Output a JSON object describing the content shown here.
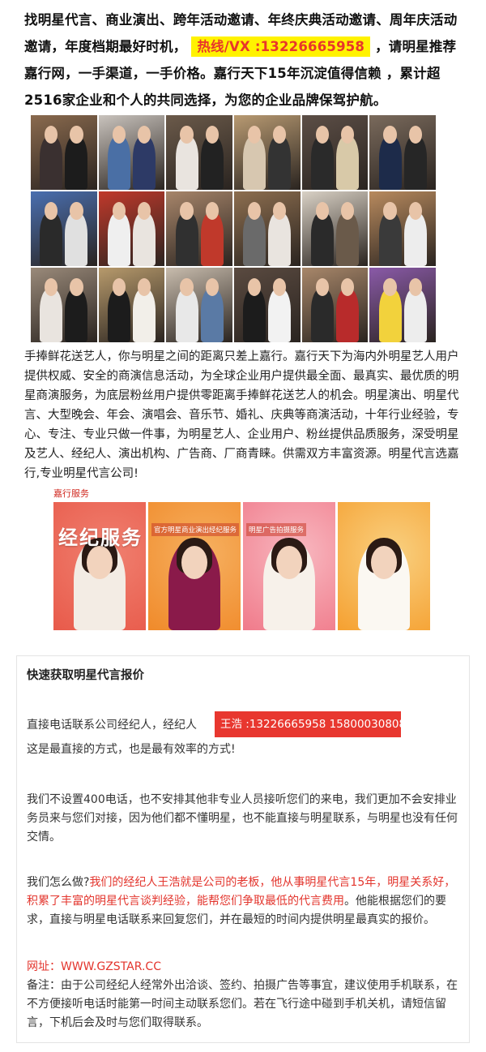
{
  "intro": {
    "text_before": "找明星代言、商业演出、跨年活动邀请、年终庆典活动邀请、周年庆活动邀请，年度档期最好时机，",
    "hotline": "热线/VX :13226665958",
    "text_after": "，请明星推荐嘉行网，一手渠道，一手价格。嘉行天下15年沉淀值得信赖 ，累计超2516家企业和个人的共同选择，为您的企业品牌保驾护航。"
  },
  "photos": [
    {
      "bg": "#8a6a4e",
      "a": "#3a3030",
      "b": "#1c1c1c"
    },
    {
      "bg": "#c9c3bd",
      "a": "#4a6fa5",
      "b": "#2d3a66"
    },
    {
      "bg": "#6b5a4a",
      "a": "#e9e4df",
      "b": "#222222"
    },
    {
      "bg": "#b89a72",
      "a": "#d7c7b0",
      "b": "#333333"
    },
    {
      "bg": "#5c4e46",
      "a": "#2a2a2a",
      "b": "#d8c9a8"
    },
    {
      "bg": "#7a6a5c",
      "a": "#1d2b4a",
      "b": "#262626"
    },
    {
      "bg": "#4a6fb0",
      "a": "#2a2a2a",
      "b": "#e0e0e0"
    },
    {
      "bg": "#c0392b",
      "a": "#efefef",
      "b": "#e9e4df"
    },
    {
      "bg": "#a7856a",
      "a": "#303030",
      "b": "#c0392b"
    },
    {
      "bg": "#8d6e4f",
      "a": "#6a6a6a",
      "b": "#e9e4df"
    },
    {
      "bg": "#d9d1c5",
      "a": "#2a2a2a",
      "b": "#6a5a4a"
    },
    {
      "bg": "#b88a5e",
      "a": "#3a3a3a",
      "b": "#ededed"
    },
    {
      "bg": "#9a8a7a",
      "a": "#e9e4df",
      "b": "#1c1c1c"
    },
    {
      "bg": "#b79a6c",
      "a": "#1c1c1c",
      "b": "#f2efe9"
    },
    {
      "bg": "#c8bcad",
      "a": "#e8e8e8",
      "b": "#5a7aa5"
    },
    {
      "bg": "#5a4a40",
      "a": "#1c1c1c",
      "b": "#f2f2f2"
    },
    {
      "bg": "#a8876a",
      "a": "#2a2a2a",
      "b": "#b82b2b"
    },
    {
      "bg": "#8a5aa8",
      "a": "#f2d23c",
      "b": "#ededed"
    }
  ],
  "body_text": "手捧鲜花送艺人，你与明星之间的距离只差上嘉行。嘉行天下为海内外明星艺人用户提供权威、安全的商演信息活动，为全球企业用户提供最全面、最真实、最优质的明星商演服务，为底层粉丝用户提供零距离手捧鲜花送艺人的机会。明星演出、明星代言、大型晚会、年会、演唱会、音乐节、婚礼、庆典等商演活动，十年行业经验，专心、专注、专业只做一件事，为明星艺人、企业用户、粉丝提供品质服务，深受明星及艺人、经纪人、演出机构、广告商、厂商青睐。供需双方丰富资源。明星代言选嘉行,专业明星代言公司!",
  "services": {
    "label": "嘉行服务",
    "cards": [
      {
        "title_big": "经纪服务",
        "title_small": "",
        "bg": "#e85a4a",
        "bg2": "#f08070",
        "outfit": "#f3ece4"
      },
      {
        "title_big": "",
        "title_small": "官方明星商业演出经纪服务",
        "bg": "#f08a2a",
        "bg2": "#f6b060",
        "outfit": "#8a1a4a"
      },
      {
        "title_big": "",
        "title_small": "明星广告拍摄服务",
        "bg": "#f07a8a",
        "bg2": "#f8b8c0",
        "outfit": "#f7f1ea"
      },
      {
        "title_big": "",
        "title_small": "",
        "bg": "#f5a030",
        "bg2": "#f9d080",
        "outfit": "#fbf8f2"
      }
    ]
  },
  "quote": {
    "title": "快速获取明星代言报价",
    "contact_line": "直接电话联系公司经纪人，经纪人",
    "agent_badge": "王浩 :13226665958  15800030808",
    "direct_line": "这是最直接的方式，也是最有效率的方式!",
    "no400": "我们不设置400电话，也不安排其他非专业人员接听您们的来电，我们更加不会安排业务员来与您们对接，因为他们都不懂明星，也不能直接与明星联系，与明星也没有任何交情。",
    "how_q": "我们怎么做?",
    "how_red": "我们的经纪人王浩就是公司的老板，他从事明星代言15年，明星关系好，积累了丰富的明星代言谈判经验，能帮您们争取最低的代言费用",
    "how_rest": "。他能根据您们的要求，直接与明星电话联系来回复您们，并在最短的时间内提供明星最真实的报价。",
    "website": "网址：WWW.GZSTAR.CC",
    "note": "备注：由于公司经纪人经常外出洽谈、签约、拍摄广告等事宜，建议使用手机联系，在不方便接听电话时能第一时间主动联系您们。若在飞行途中碰到手机关机，请短信留言，下机后会及时与您们取得联系。"
  }
}
